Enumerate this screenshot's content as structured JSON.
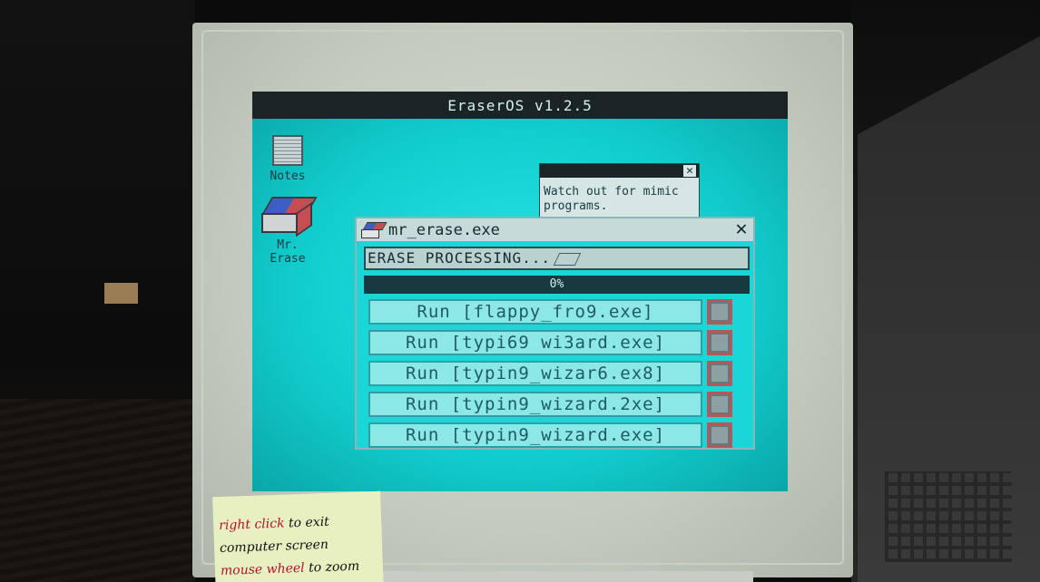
{
  "os": {
    "title": "EraserOS v1.2.5"
  },
  "desktop_icons": [
    {
      "label": "Notes",
      "icon": "notes-icon"
    },
    {
      "label": "Mr.\nErase",
      "icon": "eraser-icon"
    }
  ],
  "hint_window": {
    "close_label": "✕",
    "text": "Watch out for mimic programs."
  },
  "main_window": {
    "title": "mr_erase.exe",
    "close_label": "✕",
    "status": "ERASE PROCESSING...",
    "progress": {
      "label": "0%",
      "fraction": 0.0
    },
    "run_buttons": [
      {
        "label": "Run [flappy_fro9.exe]"
      },
      {
        "label": "Run [typi69 wi3ard.exe]"
      },
      {
        "label": "Run [typin9_wizar6.ex8]"
      },
      {
        "label": "Run [typin9_wizard.2xe]"
      },
      {
        "label": "Run [typin9_wizard.exe]"
      }
    ]
  },
  "sticky_note": {
    "line1_red": "right click",
    "line1_rest": " to exit",
    "line2": "computer screen",
    "line3_red": "mouse wheel",
    "line3_rest": " to zoom"
  },
  "colors": {
    "screen": "#12cccc",
    "titlebar": "#1a2424",
    "checkbox_border": "#b7565c"
  }
}
